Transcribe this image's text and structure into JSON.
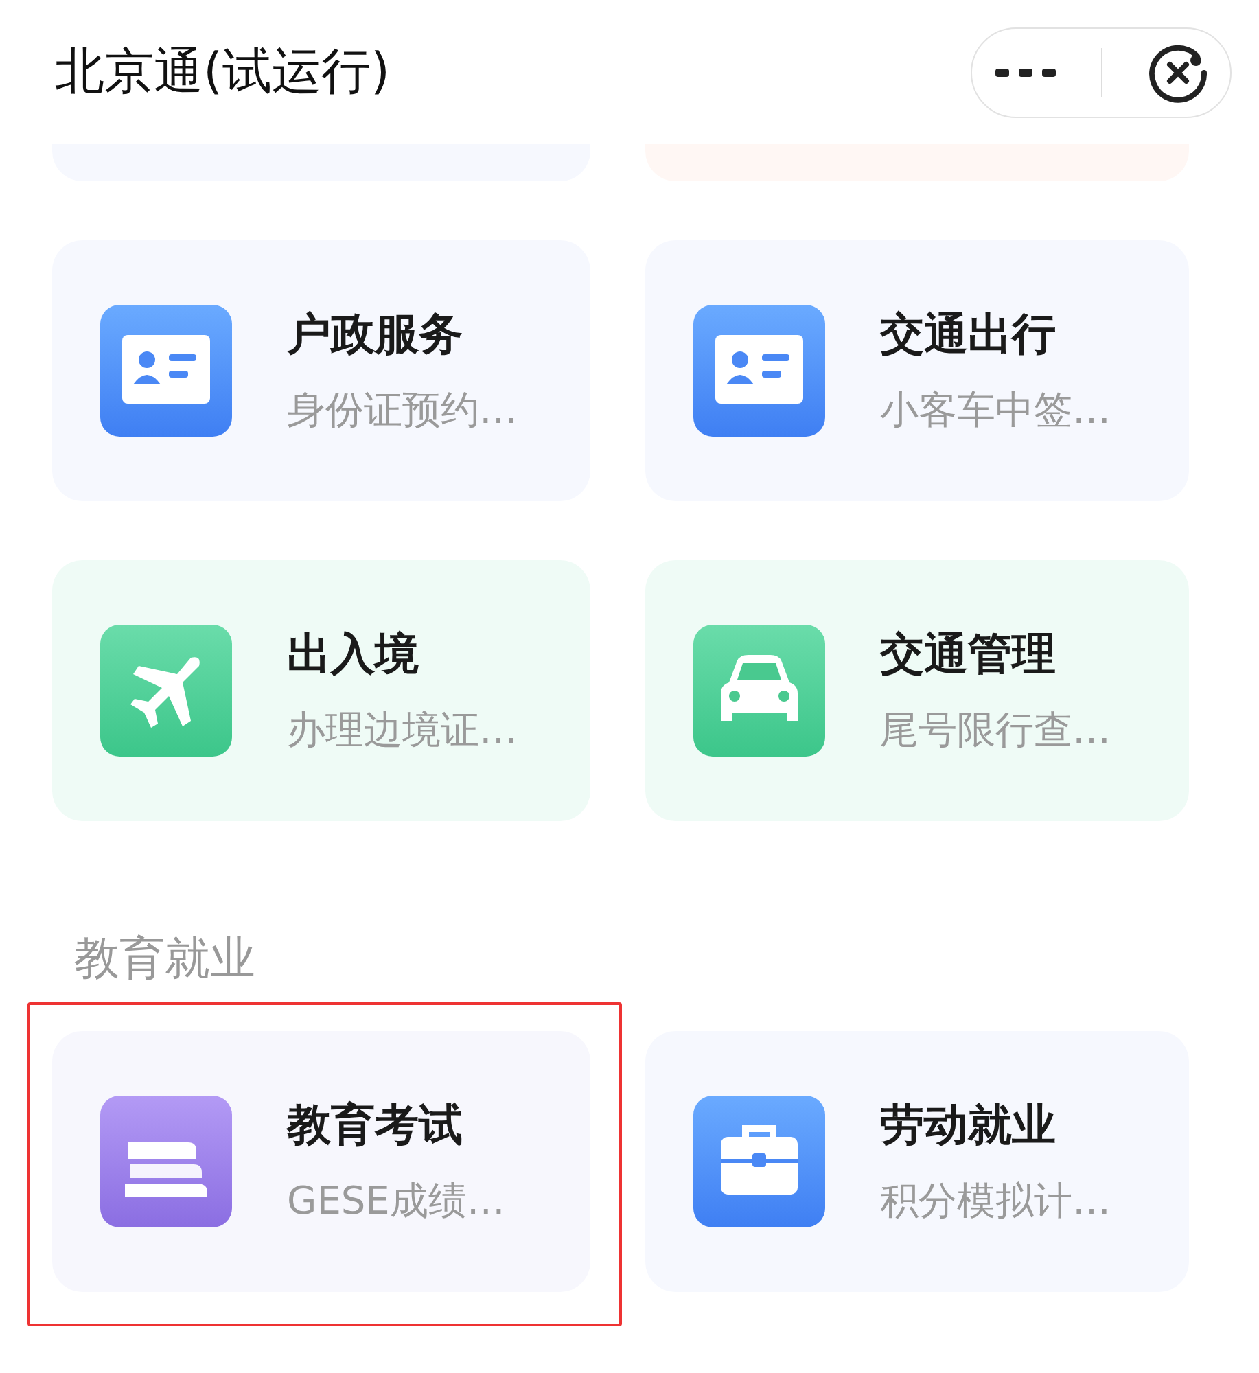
{
  "header": {
    "title": "北京通(试运行)"
  },
  "sections": [
    {
      "cards": [
        {
          "title": "户政服务",
          "subtitle": "身份证预约…",
          "kind": "id-card",
          "color": "#f6f8fe",
          "highlighted": false
        },
        {
          "title": "交通出行",
          "subtitle": "小客车中签…",
          "kind": "id-card",
          "color": "#f6f8fe",
          "highlighted": false
        },
        {
          "title": "出入境",
          "subtitle": "办理边境证…",
          "kind": "plane",
          "color": "#effbf6",
          "highlighted": false
        },
        {
          "title": "交通管理",
          "subtitle": "尾号限行查…",
          "kind": "car",
          "color": "#effbf6",
          "highlighted": false
        }
      ]
    },
    {
      "label": "教育就业",
      "cards": [
        {
          "title": "教育考试",
          "subtitle": "GESE成绩…",
          "kind": "books",
          "color": "#f7f7fd",
          "highlighted": true
        },
        {
          "title": "劳动就业",
          "subtitle": "积分模拟计…",
          "kind": "briefcase",
          "color": "#f6f8fe",
          "highlighted": false
        }
      ]
    }
  ]
}
